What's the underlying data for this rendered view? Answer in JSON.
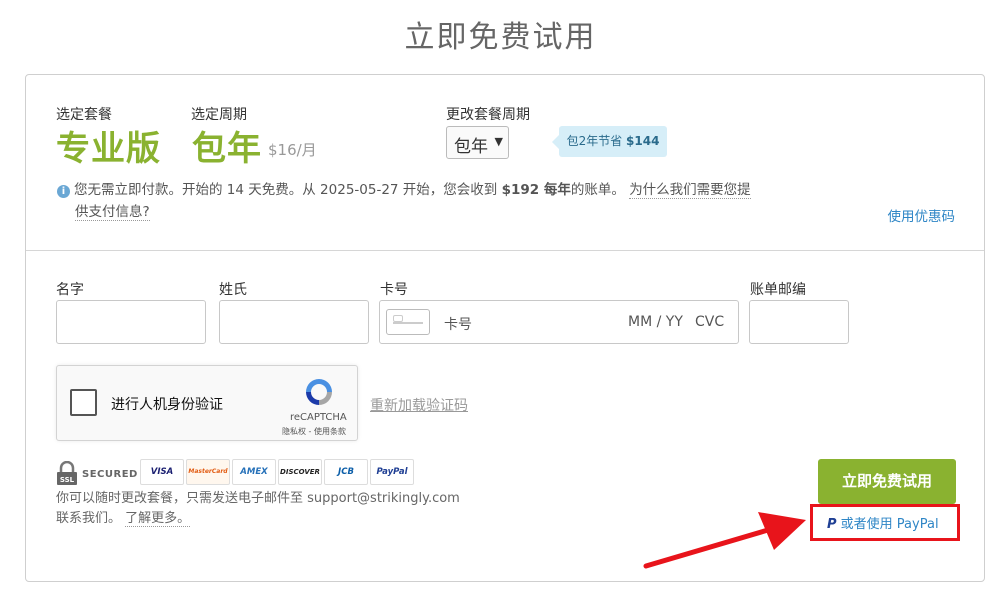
{
  "page_title": "立即免费试用",
  "plan": {
    "plan_label": "选定套餐",
    "plan_value": "专业版",
    "period_label": "选定周期",
    "period_value": "包年",
    "price": "$16/月",
    "change_label": "更改套餐周期",
    "period_select": "包年",
    "savings_prefix": "包2年节省",
    "savings_amount": "$144"
  },
  "info": {
    "text_1": "您无需立即付款。开始的 14 天免费。从 2025-05-27 开始，您会收到",
    "amount": "$192 每年",
    "text_2": "的账单。",
    "why_link": "为什么我们需要您提",
    "why_link_2": "供支付信息?"
  },
  "coupon_link": "使用优惠码",
  "form": {
    "first_name_label": "名字",
    "last_name_label": "姓氏",
    "card_label": "卡号",
    "card_placeholder": "卡号",
    "expiry_placeholder": "MM / YY",
    "cvc_placeholder": "CVC",
    "zip_label": "账单邮编"
  },
  "captcha": {
    "checkbox_label": "进行人机身份验证",
    "brand": "reCAPTCHA",
    "terms": "隐私权 - 使用条款",
    "reload_link": "重新加载验证码"
  },
  "security": {
    "ssl_badge": "SECURED",
    "ssl_icon_text": "SSL",
    "cards": [
      "VISA",
      "MasterCard",
      "AMEX",
      "DISCOVER",
      "JCB",
      "PayPal"
    ]
  },
  "footer": {
    "text": "你可以随时更改套餐，只需发送电子邮件至 support@strikingly.com 联系我们。",
    "learn_more": "了解更多。"
  },
  "cta_button": "立即免费试用",
  "paypal_link": "或者使用 PayPal",
  "colors": {
    "brand_green": "#8ab230",
    "link_blue": "#2f86c6",
    "highlight_red": "#e8141b"
  }
}
